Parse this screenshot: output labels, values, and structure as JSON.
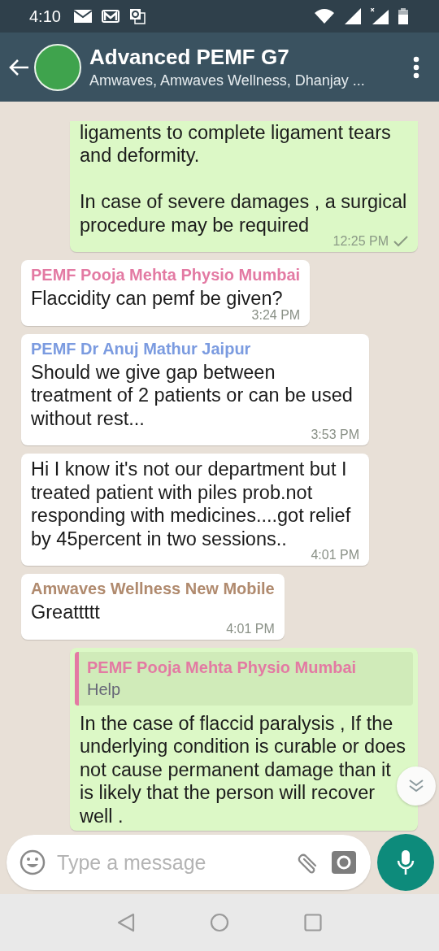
{
  "status_bar": {
    "time": "4:10"
  },
  "header": {
    "title": "Advanced PEMF G7",
    "subtitle": "Amwaves, Amwaves Wellness, Dhanjay ..."
  },
  "messages": [
    {
      "kind": "outgoing",
      "paragraphs": [
        "ligaments to complete ligament tears and deformity.",
        "In case of severe damages , a surgical procedure may be required"
      ],
      "time": "12:25 PM",
      "read": false
    },
    {
      "kind": "incoming",
      "sender": "PEMF Pooja Mehta Physio Mumbai",
      "color": "#e37aa3",
      "paragraphs": [
        "Flaccidity can pemf be given?"
      ],
      "time": "3:24 PM"
    },
    {
      "kind": "incoming",
      "sender": "PEMF Dr Anuj Mathur Jaipur",
      "color": "#7b9be0",
      "paragraphs": [
        "Should we give gap between treatment of  2 patients or can be used without rest..."
      ],
      "time": "3:53 PM"
    },
    {
      "kind": "incoming",
      "paragraphs": [
        "Hi I know it's not our department but I treated patient with piles prob.not responding with medicines....got relief by 45percent in two sessions.."
      ],
      "time": "4:01 PM"
    },
    {
      "kind": "incoming",
      "sender": "Amwaves Wellness New Mobile",
      "color": "#b08a6e",
      "paragraphs": [
        "Greattttt"
      ],
      "time": "4:01 PM"
    },
    {
      "kind": "outgoing",
      "quote": {
        "sender": "PEMF Pooja Mehta Physio Mumbai",
        "color": "#e37aa3",
        "text": "Help"
      },
      "paragraphs": [
        "In the case of flaccid paralysis , If the underlying condition is curable or does not cause permanent damage than it is likely that the person will recover well ."
      ]
    }
  ],
  "composer": {
    "placeholder": "Type a message"
  }
}
